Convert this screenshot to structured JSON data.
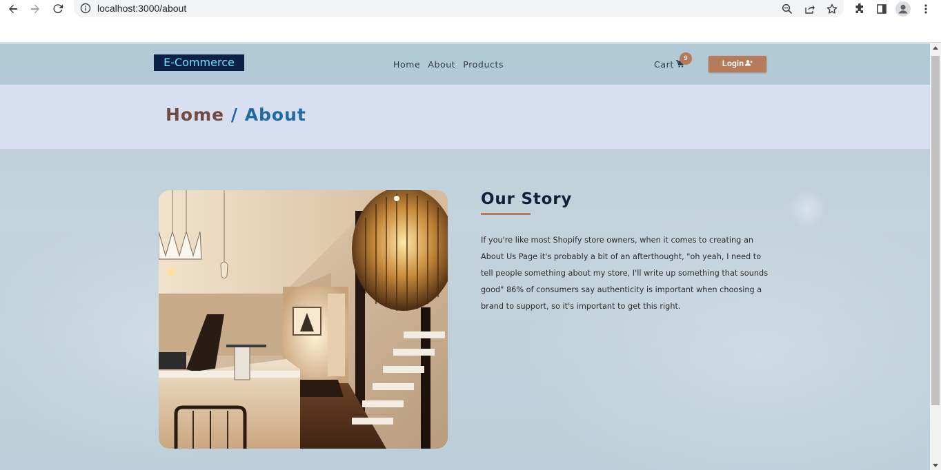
{
  "browser": {
    "url": "localhost:3000/about",
    "icons": [
      "back-arrow-icon",
      "forward-arrow-icon",
      "reload-icon",
      "info-icon",
      "zoom-out-icon",
      "share-icon",
      "star-icon",
      "extensions-icon",
      "side-panel-icon",
      "profile-icon",
      "menu-icon"
    ]
  },
  "header": {
    "logo": "E-Commerce",
    "nav": [
      {
        "label": "Home"
      },
      {
        "label": "About"
      },
      {
        "label": "Products"
      }
    ],
    "cart_label": "Cart",
    "cart_count": "9",
    "login_label": "Login"
  },
  "breadcrumb": {
    "home": "Home",
    "separator": "/",
    "current": "About"
  },
  "story": {
    "title": "Our Story",
    "text": "If you're like most Shopify store owners, when it comes to creating an About Us Page it's probably a bit of an afterthought, \"oh yeah, I need to tell people something about my store, I'll write up something that sounds good\" 86% of consumers say authenticity is important when choosing a brand to support, so it's important to get this right."
  },
  "colors": {
    "accent": "#b67b5b",
    "logo_bg": "#0b2147",
    "logo_text": "#6fe3ff",
    "crumb_current": "#1e6aa8",
    "crumb_home": "#6f4c3e",
    "title": "#0d2238"
  }
}
